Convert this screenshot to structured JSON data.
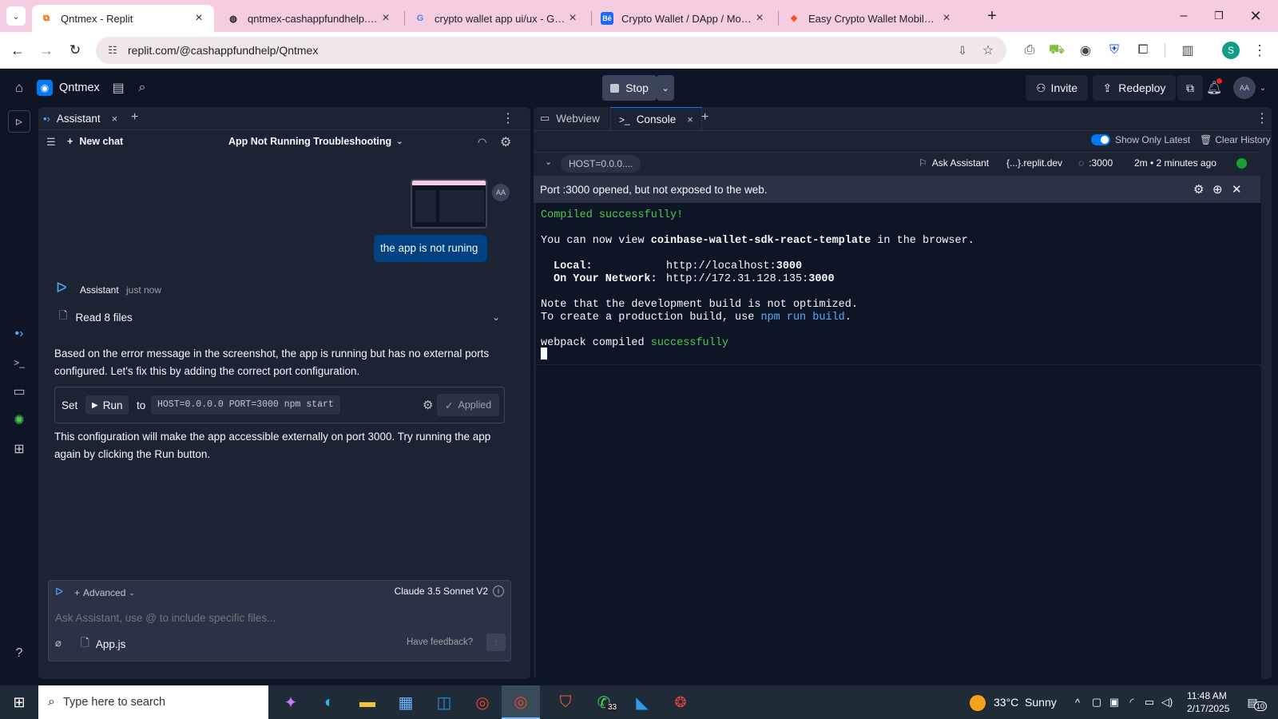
{
  "browser": {
    "tabs": [
      {
        "title": "Qntmex - Replit",
        "icon": "replit-icon",
        "active": true
      },
      {
        "title": "qntmex-cashappfundhelp.replit",
        "icon": "globe-icon",
        "active": false
      },
      {
        "title": "crypto wallet app ui/ux - Googl",
        "icon": "google-icon",
        "active": false
      },
      {
        "title": "Crypto Wallet / DApp / Mobile",
        "icon": "behance-icon",
        "active": false
      },
      {
        "title": "Easy Crypto Wallet Mobile App",
        "icon": "figma-icon",
        "active": false
      }
    ],
    "url": "replit.com/@cashappfundhelp/Qntmex",
    "profile_initial": "S"
  },
  "header": {
    "project_name": "Qntmex",
    "stop_label": "Stop",
    "invite_label": "Invite",
    "redeploy_label": "Redeploy",
    "avatar": "AA"
  },
  "assistant": {
    "tab_label": "Assistant",
    "new_chat_label": "New chat",
    "chat_title": "App Not Running Troubleshooting",
    "user_avatar": "AA",
    "user_message": "the app is not runing",
    "assistant_name": "Assistant",
    "assistant_time": "just now",
    "read_files_label": "Read 8 files",
    "message_1": "Based on the error message in the screenshot, the app is running but has no external ports configured. Let's fix this by adding the correct port configuration.",
    "action": {
      "set_label": "Set",
      "run_label": "Run",
      "to_label": "to",
      "command": "HOST=0.0.0.0 PORT=3000 npm start",
      "applied_label": "Applied"
    },
    "message_2": "This configuration will make the app accessible externally on port 3000. Try running the app again by clicking the Run button.",
    "input": {
      "mode_label": "Advanced",
      "model_label": "Claude 3.5 Sonnet V2",
      "placeholder": "Ask Assistant, use @ to include specific files...",
      "file_chip": "App.js",
      "feedback_label": "Have feedback?"
    }
  },
  "console": {
    "tabs": [
      {
        "label": "Webview",
        "active": false
      },
      {
        "label": "Console",
        "active": true
      }
    ],
    "show_only_latest_label": "Show Only Latest",
    "clear_history_label": "Clear History",
    "process_label": "HOST=0.0.0....",
    "ask_assistant_label": "Ask Assistant",
    "domain_label": "{...}.replit.dev",
    "port_label": ":3000",
    "time_label": "2m • 2 minutes ago",
    "port_notice": "Port :3000 opened, but not exposed to the web.",
    "output": {
      "compiled": "Compiled successfully!",
      "view_prefix": "You can now view ",
      "view_app": "coinbase-wallet-sdk-react-template",
      "view_suffix": " in the browser.",
      "local_label": "Local:",
      "local_url_prefix": "http://localhost:",
      "local_port": "3000",
      "network_label": "On Your Network:",
      "network_url_prefix": "http://172.31.128.135:",
      "network_port": "3000",
      "note_line": "Note that the development build is not optimized.",
      "prod_prefix": "To create a production build, use ",
      "prod_cmd": "npm run build",
      "prod_suffix": ".",
      "webpack_prefix": "webpack compiled ",
      "webpack_status": "successfully"
    }
  },
  "taskbar": {
    "search_placeholder": "Type here to search",
    "weather": "33°C  Sunny",
    "time": "11:48 AM",
    "date": "2/17/2025",
    "whatsapp_badge": "33",
    "notification_count": "10"
  },
  "colors": {
    "tab_strip": "#f6cce0",
    "ide_bg": "#0e1525",
    "panel_bg": "#1c2333",
    "accent_blue": "#0079f2",
    "success_green": "#4ec94e"
  }
}
